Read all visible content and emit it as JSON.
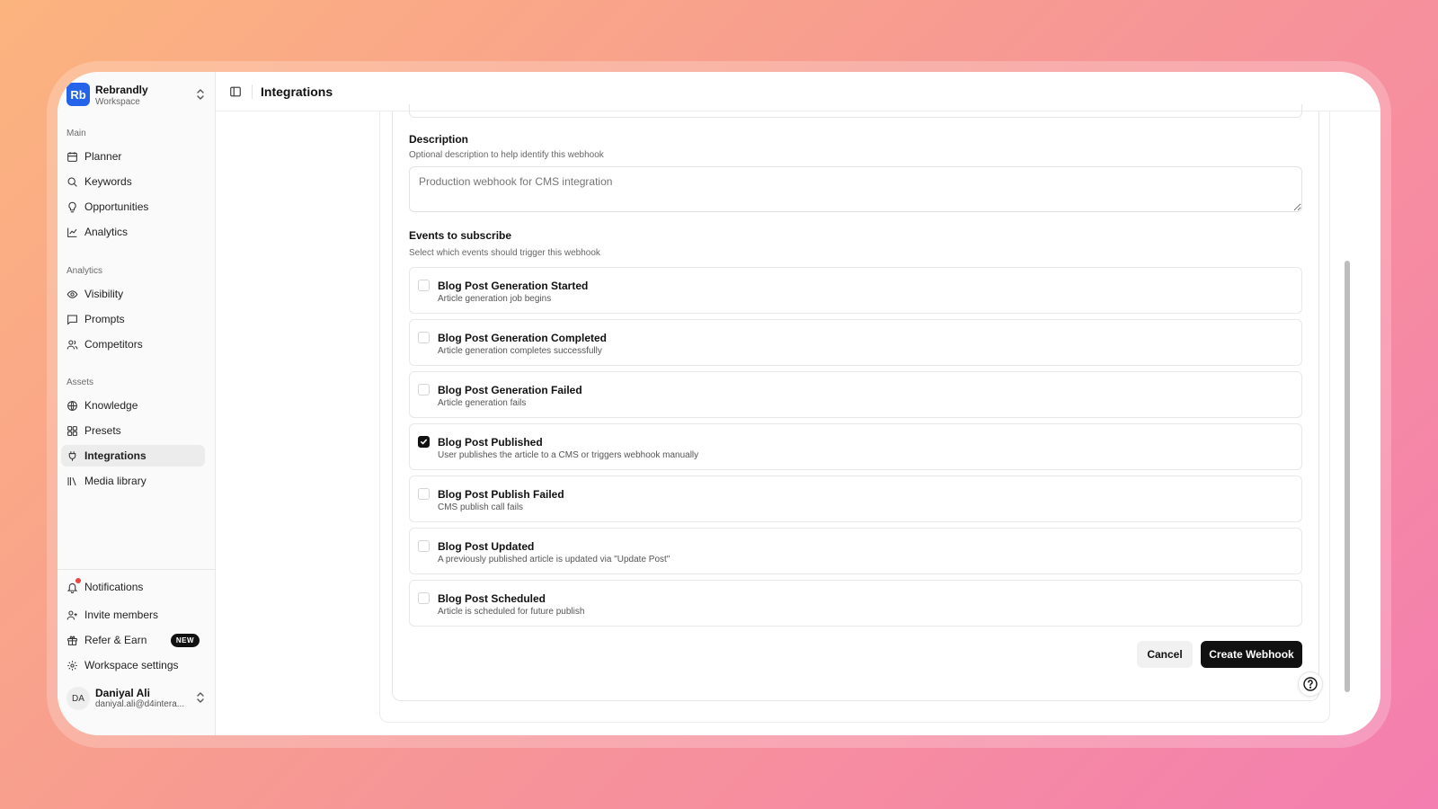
{
  "workspace": {
    "logo": "Rb",
    "name": "Rebrandly",
    "subtitle": "Workspace"
  },
  "sidebar": {
    "sections": [
      {
        "label": "Main",
        "items": [
          {
            "label": "Planner",
            "icon": "calendar-icon"
          },
          {
            "label": "Keywords",
            "icon": "search-icon"
          },
          {
            "label": "Opportunities",
            "icon": "lightbulb-icon"
          },
          {
            "label": "Analytics",
            "icon": "line-chart-icon"
          }
        ]
      },
      {
        "label": "Analytics",
        "items": [
          {
            "label": "Visibility",
            "icon": "eye-icon"
          },
          {
            "label": "Prompts",
            "icon": "message-square-icon"
          },
          {
            "label": "Competitors",
            "icon": "users-icon"
          }
        ]
      },
      {
        "label": "Assets",
        "items": [
          {
            "label": "Knowledge",
            "icon": "globe-icon"
          },
          {
            "label": "Presets",
            "icon": "grid-icon"
          },
          {
            "label": "Integrations",
            "icon": "plug-icon",
            "active": true
          },
          {
            "label": "Media library",
            "icon": "library-icon"
          }
        ]
      }
    ],
    "bottom": {
      "notifications": "Notifications",
      "invite": "Invite members",
      "refer": "Refer & Earn",
      "refer_badge": "NEW",
      "settings": "Workspace settings"
    },
    "user": {
      "initials": "DA",
      "name": "Daniyal Ali",
      "email": "daniyal.ali@d4intera..."
    }
  },
  "header": {
    "title": "Integrations"
  },
  "form": {
    "description": {
      "label": "Description",
      "help": "Optional description to help identify this webhook",
      "placeholder": "Production webhook for CMS integration"
    },
    "events": {
      "label": "Events to subscribe",
      "help": "Select which events should trigger this webhook",
      "items": [
        {
          "title": "Blog Post Generation Started",
          "desc": "Article generation job begins",
          "checked": false
        },
        {
          "title": "Blog Post Generation Completed",
          "desc": "Article generation completes successfully",
          "checked": false
        },
        {
          "title": "Blog Post Generation Failed",
          "desc": "Article generation fails",
          "checked": false
        },
        {
          "title": "Blog Post Published",
          "desc": "User publishes the article to a CMS or triggers webhook manually",
          "checked": true
        },
        {
          "title": "Blog Post Publish Failed",
          "desc": "CMS publish call fails",
          "checked": false
        },
        {
          "title": "Blog Post Updated",
          "desc": "A previously published article is updated via \"Update Post\"",
          "checked": false
        },
        {
          "title": "Blog Post Scheduled",
          "desc": "Article is scheduled for future publish",
          "checked": false
        }
      ]
    },
    "cancel_label": "Cancel",
    "create_label": "Create Webhook"
  },
  "colors": {
    "accent": "#2563eb",
    "primary_button": "#111111",
    "notification_dot": "#ef4444"
  }
}
